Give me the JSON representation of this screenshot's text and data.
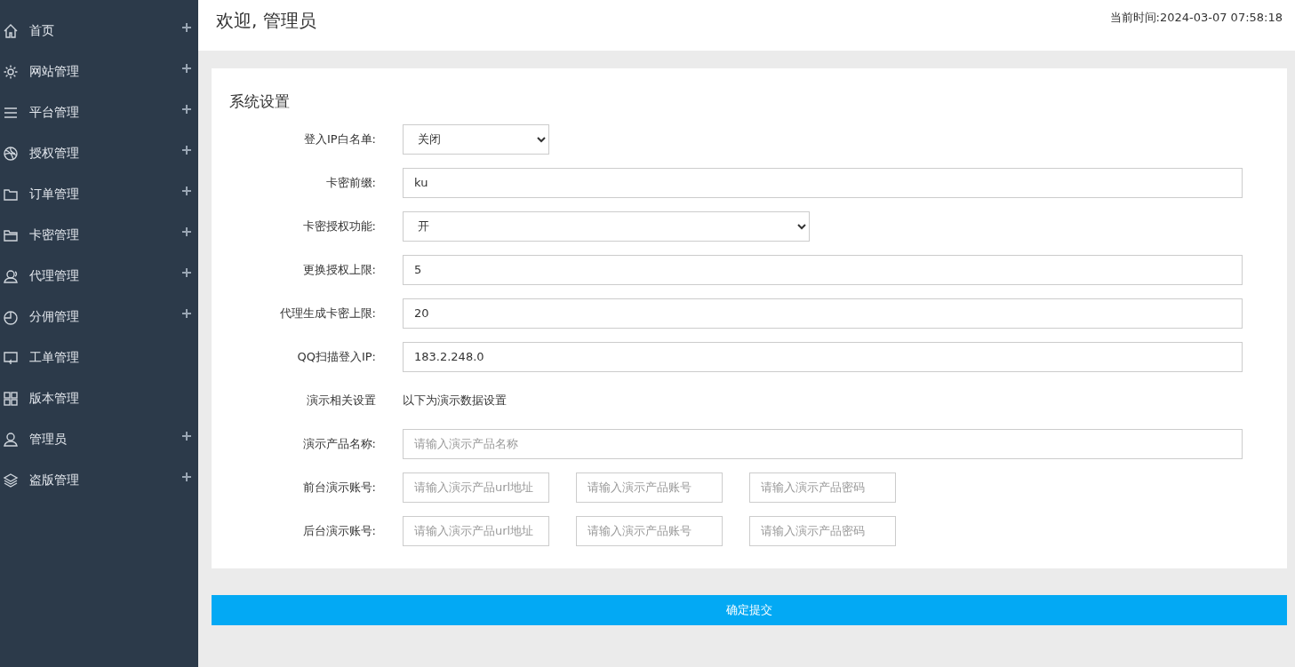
{
  "sidebar": {
    "items": [
      {
        "label": "首页",
        "expandable": true
      },
      {
        "label": "网站管理",
        "expandable": true
      },
      {
        "label": "平台管理",
        "expandable": true
      },
      {
        "label": "授权管理",
        "expandable": true
      },
      {
        "label": "订单管理",
        "expandable": true
      },
      {
        "label": "卡密管理",
        "expandable": true
      },
      {
        "label": "代理管理",
        "expandable": true
      },
      {
        "label": "分佣管理",
        "expandable": true
      },
      {
        "label": "工单管理",
        "expandable": false
      },
      {
        "label": "版本管理",
        "expandable": false
      },
      {
        "label": "管理员",
        "expandable": true
      },
      {
        "label": "盗版管理",
        "expandable": true
      }
    ]
  },
  "header": {
    "title": "欢迎, 管理员",
    "time": "当前时间:2024-03-07 07:58:18"
  },
  "form": {
    "title": "系统设置",
    "rows": [
      {
        "kind": "short-select",
        "label": "登入IP白名单:",
        "value": "关闭"
      },
      {
        "kind": "input",
        "label": "卡密前缀:",
        "value": "ku"
      },
      {
        "kind": "select",
        "label": "卡密授权功能:",
        "value": "开"
      },
      {
        "kind": "input",
        "label": "更换授权上限:",
        "value": "5"
      },
      {
        "kind": "input",
        "label": "代理生成卡密上限:",
        "value": "20"
      },
      {
        "kind": "input",
        "label": "QQ扫描登入IP:",
        "value": "183.2.248.0"
      },
      {
        "kind": "note",
        "label": "演示相关设置",
        "value": "以下为演示数据设置"
      },
      {
        "kind": "input",
        "label": "演示产品名称:",
        "placeholder": "请输入演示产品名称"
      },
      {
        "kind": "triple",
        "label": "前台演示账号:",
        "fields": [
          {
            "placeholder": "请输入演示产品url地址"
          },
          {
            "placeholder": "请输入演示产品账号"
          },
          {
            "placeholder": "请输入演示产品密码"
          }
        ]
      },
      {
        "kind": "triple",
        "label": "后台演示账号:",
        "fields": [
          {
            "placeholder": "请输入演示产品url地址"
          },
          {
            "placeholder": "请输入演示产品账号"
          },
          {
            "placeholder": "请输入演示产品密码"
          }
        ]
      }
    ]
  },
  "submit": "确定提交"
}
